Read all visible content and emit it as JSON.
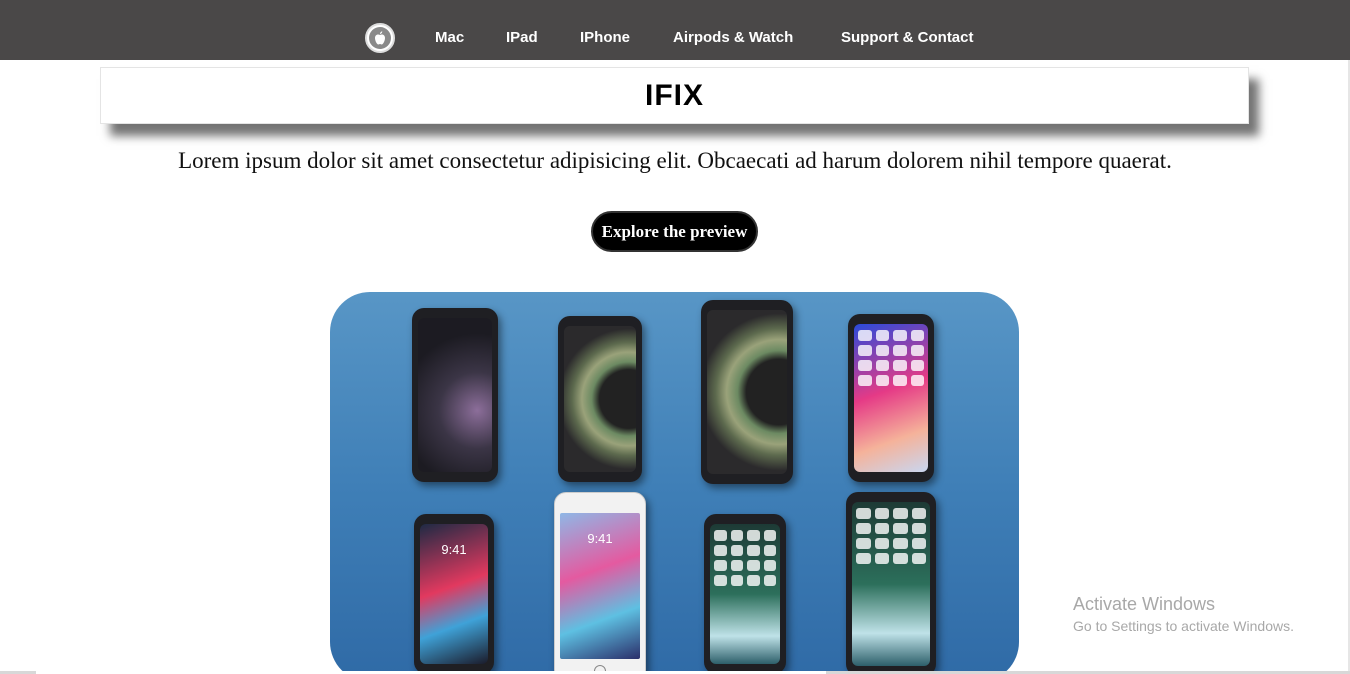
{
  "nav": {
    "logo_icon": "apple-logo-icon",
    "links": [
      "Mac",
      "IPad",
      "IPhone",
      "Airpods & Watch",
      "Support & Contact"
    ]
  },
  "hero": {
    "title": "IFIX",
    "lead": "Lorem ipsum dolor sit amet consectetur adipisicing elit. Obcaecati ad harum dolorem nihil tempore quaerat.",
    "cta_label": "Explore the preview"
  },
  "phones": {
    "clock_time": "9:41"
  },
  "watermark": {
    "line1": "Activate Windows",
    "line2": "Go to Settings to activate Windows."
  },
  "colors": {
    "navbar": "#4a4848",
    "button": "#000000",
    "image_blue": "#3f7fb7"
  }
}
